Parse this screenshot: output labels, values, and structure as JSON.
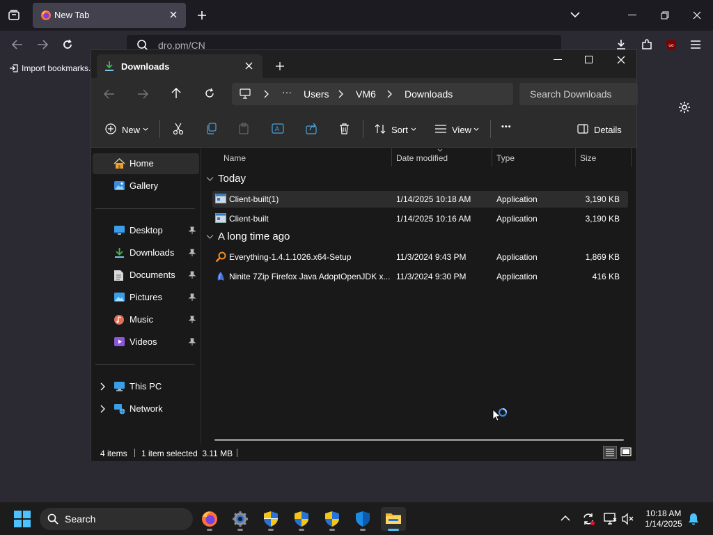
{
  "browser": {
    "tab_title": "New Tab",
    "url_text": "dro.pm/CN",
    "bookmark_label": "Import bookmarks..."
  },
  "explorer": {
    "tab_title": "Downloads",
    "breadcrumb": [
      "Users",
      "VM6",
      "Downloads"
    ],
    "breadcrumb_more": "···",
    "search_placeholder": "Search Downloads",
    "commands": {
      "new_label": "New",
      "sort_label": "Sort",
      "view_label": "View",
      "more_label": "•••",
      "details_label": "Details"
    },
    "nav": {
      "home": "Home",
      "gallery": "Gallery",
      "quick_access": [
        {
          "label": "Desktop",
          "icon": "desktop-icon"
        },
        {
          "label": "Downloads",
          "icon": "downloads-icon"
        },
        {
          "label": "Documents",
          "icon": "documents-icon"
        },
        {
          "label": "Pictures",
          "icon": "pictures-icon"
        },
        {
          "label": "Music",
          "icon": "music-icon"
        },
        {
          "label": "Videos",
          "icon": "videos-icon"
        }
      ],
      "this_pc": "This PC",
      "network": "Network"
    },
    "columns": {
      "name": "Name",
      "date": "Date modified",
      "type": "Type",
      "size": "Size"
    },
    "groups": [
      {
        "label": "Today",
        "files": [
          {
            "name": "Client-built(1)",
            "date": "1/14/2025 10:18 AM",
            "type": "Application",
            "size": "3,190 KB",
            "icon": "exe-window-icon",
            "selected": true
          },
          {
            "name": "Client-built",
            "date": "1/14/2025 10:16 AM",
            "type": "Application",
            "size": "3,190 KB",
            "icon": "exe-window-icon",
            "selected": false
          }
        ]
      },
      {
        "label": "A long time ago",
        "files": [
          {
            "name": "Everything-1.4.1.1026.x64-Setup",
            "date": "11/3/2024 9:43 PM",
            "type": "Application",
            "size": "1,869 KB",
            "icon": "magnifier-orange-icon",
            "selected": false
          },
          {
            "name": "Ninite 7Zip Firefox Java AdoptOpenJDK x...",
            "date": "11/3/2024 9:30 PM",
            "type": "Application",
            "size": "416 KB",
            "icon": "ninite-icon",
            "selected": false
          }
        ]
      }
    ],
    "status": {
      "items": "4 items",
      "selection": "1 item selected  3.11 MB"
    }
  },
  "taskbar": {
    "search_label": "Search",
    "time": "10:18 AM",
    "date": "1/14/2025"
  },
  "colors": {
    "accent": "#0078d4",
    "selected_row": "#2d2d2d",
    "explorer_bg": "#191919",
    "browser_bg": "#2b2a33"
  }
}
